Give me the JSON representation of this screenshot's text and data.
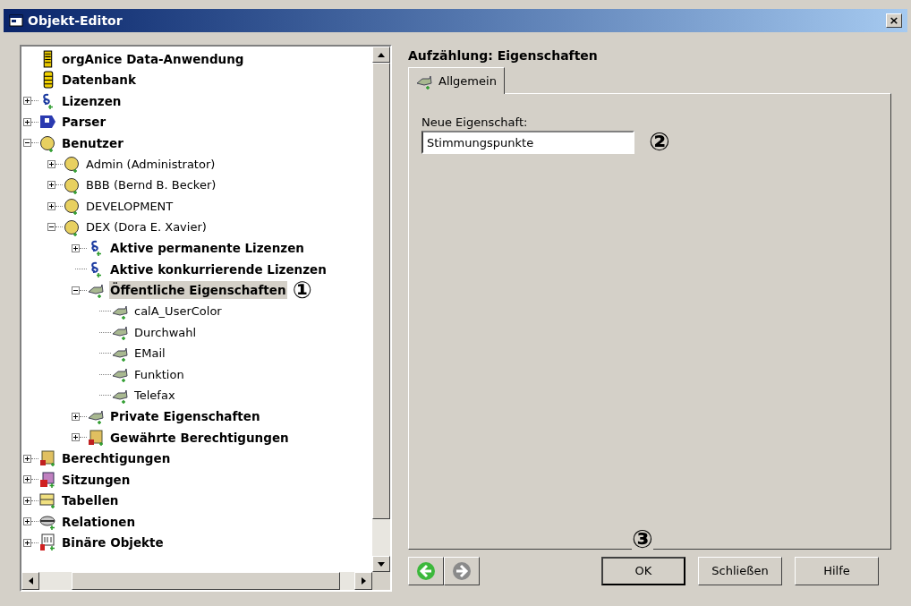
{
  "window": {
    "title": "Objekt-Editor",
    "close": "×"
  },
  "tree": [
    {
      "label": "orgAnice Data-Anwendung",
      "kind": "app",
      "bold": true,
      "selected": false
    },
    {
      "label": "Datenbank",
      "kind": "database",
      "bold": true,
      "selected": false
    },
    {
      "label": "Lizenzen",
      "kind": "license",
      "bold": true,
      "expanded": false,
      "selected": false
    },
    {
      "label": "Parser",
      "kind": "parser",
      "bold": true,
      "expanded": false,
      "selected": false
    },
    {
      "label": "Benutzer",
      "kind": "user",
      "bold": true,
      "expanded": true,
      "selected": false,
      "children": [
        {
          "label": "Admin (Administrator)",
          "kind": "user",
          "bold": false,
          "expanded": false,
          "selected": false
        },
        {
          "label": "BBB (Bernd B. Becker)",
          "kind": "user",
          "bold": false,
          "expanded": false,
          "selected": false
        },
        {
          "label": "DEVELOPMENT",
          "kind": "user",
          "bold": false,
          "expanded": false,
          "selected": false
        },
        {
          "label": "DEX (Dora E. Xavier)",
          "kind": "user",
          "bold": false,
          "expanded": true,
          "selected": false,
          "children": [
            {
              "label": "Aktive permanente Lizenzen",
              "kind": "license",
              "bold": true,
              "expanded": false,
              "selected": false
            },
            {
              "label": "Aktive konkurrierende Lizenzen",
              "kind": "license",
              "bold": true,
              "selected": false
            },
            {
              "label": "Öffentliche Eigenschaften",
              "kind": "property",
              "bold": true,
              "expanded": true,
              "selected": true,
              "marker": "①",
              "children": [
                {
                  "label": "calA_UserColor",
                  "kind": "property",
                  "bold": false,
                  "selected": false
                },
                {
                  "label": "Durchwahl",
                  "kind": "property",
                  "bold": false,
                  "selected": false
                },
                {
                  "label": "EMail",
                  "kind": "property",
                  "bold": false,
                  "selected": false
                },
                {
                  "label": "Funktion",
                  "kind": "property",
                  "bold": false,
                  "selected": false
                },
                {
                  "label": "Telefax",
                  "kind": "property",
                  "bold": false,
                  "selected": false
                }
              ]
            },
            {
              "label": "Private Eigenschaften",
              "kind": "property",
              "bold": true,
              "expanded": false,
              "selected": false
            },
            {
              "label": "Gewährte Berechtigungen",
              "kind": "permission",
              "bold": true,
              "expanded": false,
              "selected": false
            }
          ]
        }
      ]
    },
    {
      "label": "Berechtigungen",
      "kind": "permission",
      "bold": true,
      "expanded": false,
      "selected": false
    },
    {
      "label": "Sitzungen",
      "kind": "session",
      "bold": true,
      "expanded": false,
      "selected": false
    },
    {
      "label": "Tabellen",
      "kind": "table",
      "bold": true,
      "expanded": false,
      "selected": false
    },
    {
      "label": "Relationen",
      "kind": "relation",
      "bold": true,
      "expanded": false,
      "selected": false
    },
    {
      "label": "Binäre Objekte",
      "kind": "binary",
      "bold": true,
      "expanded": false,
      "selected": false
    }
  ],
  "editor": {
    "heading": "Aufzählung: Eigenschaften",
    "tabs": [
      {
        "label": "Allgemein",
        "selected": true
      }
    ],
    "field": {
      "label": "Neue Eigenschaft:",
      "value": "Stimmungspunkte",
      "marker": "②"
    }
  },
  "buttons": [
    {
      "label": "OK",
      "default": true,
      "marker": "③"
    },
    {
      "label": "Schließen",
      "default": false
    },
    {
      "label": "Hilfe",
      "default": false
    }
  ]
}
